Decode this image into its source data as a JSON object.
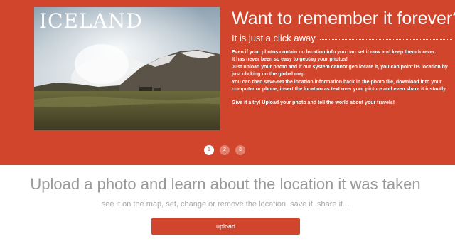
{
  "hero": {
    "photo_title": "ICELAND",
    "headline": "Want to remember it forever?",
    "subheadline": "It is just a click away",
    "paragraphs": [
      "Even if your photos contain no location info you can set it now and keep them forever.",
      "It has never been so easy to geotag your photos!",
      "Just upload your photo and if our system cannot geo locate it, you can point its location by just clicking on the global map.",
      "You can then save-set the location information back in the photo file, download it to your computer or phone, insert the location as text over your picture and even share it instantly.",
      "Give it a try! Upload your photo and tell the world about your travels!"
    ]
  },
  "pager": {
    "pages": [
      "1",
      "2",
      "3"
    ],
    "active": 0
  },
  "upload_section": {
    "title": "Upload a photo and learn about the location it was taken",
    "subtitle": "see it on the map, set, change or remove the location, save it, share it...",
    "button_label": "upload"
  },
  "colors": {
    "brand": "#d2452d",
    "muted_text": "#999999"
  }
}
